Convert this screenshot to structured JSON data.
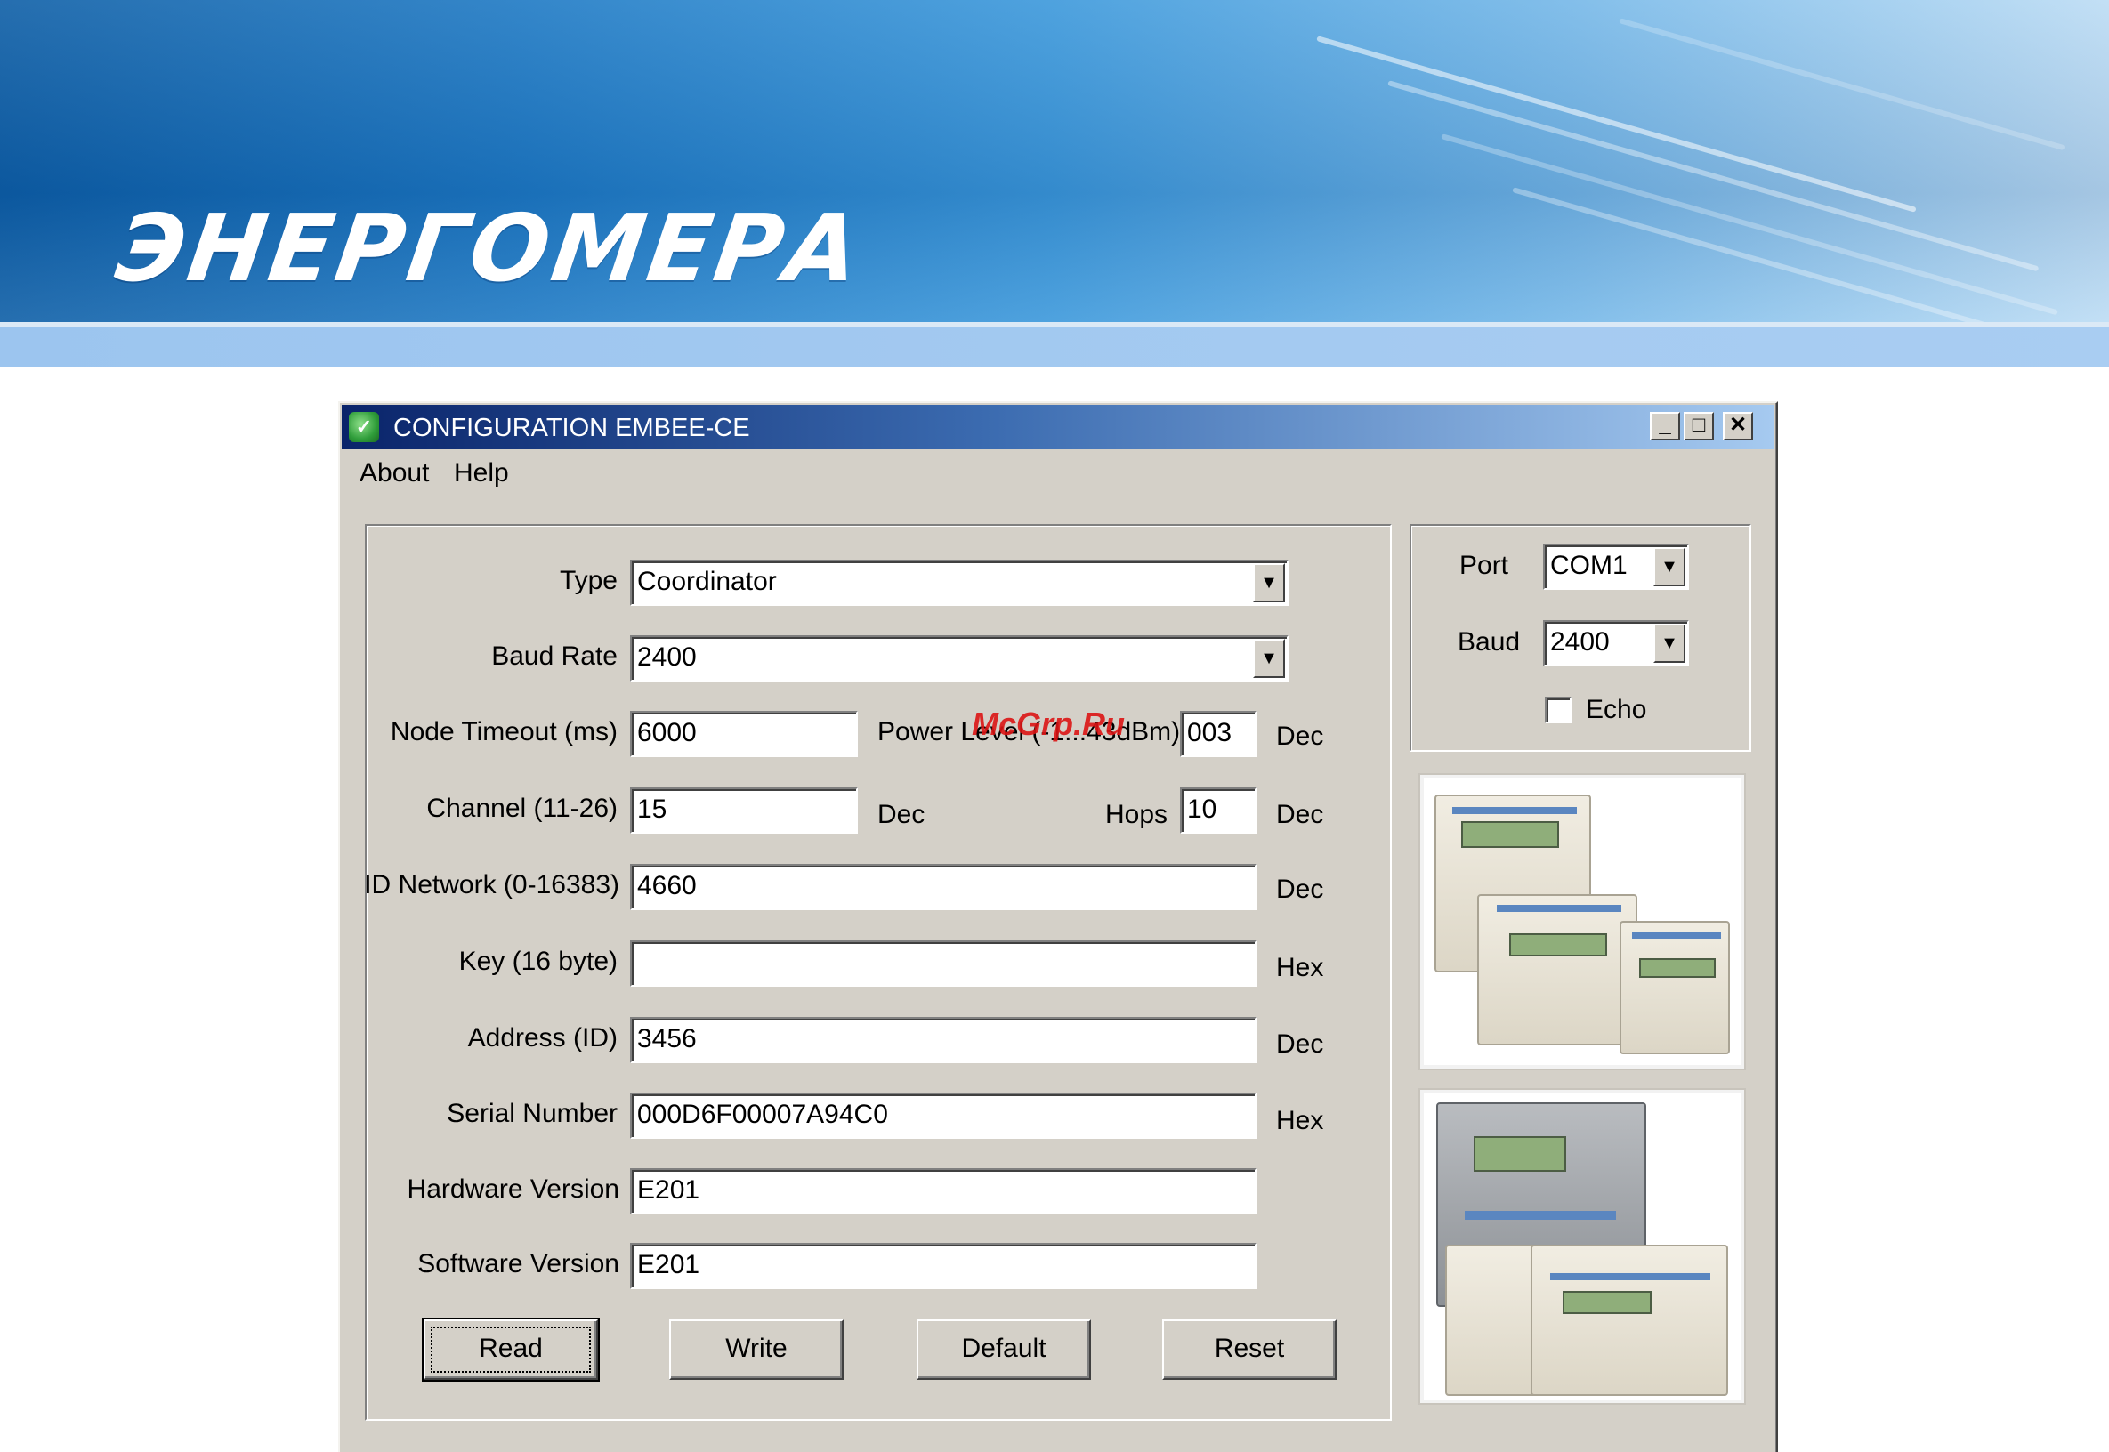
{
  "banner": {
    "logo_text": "ЭНЕРГОМЕРА"
  },
  "window": {
    "title": "CONFIGURATION EMBEE-CE",
    "minimize": "_",
    "maximize": "□",
    "close": "✕"
  },
  "menu": {
    "about": "About",
    "help": "Help"
  },
  "form": {
    "type": {
      "label": "Type",
      "value": "Coordinator"
    },
    "baud_rate": {
      "label": "Baud Rate",
      "value": "2400"
    },
    "node_timeout": {
      "label": "Node Timeout (ms)",
      "value": "6000"
    },
    "power_level": {
      "label": "Power Level (-1...43dBm)",
      "value": "003",
      "unit": "Dec"
    },
    "channel": {
      "label": "Channel (11-26)",
      "value": "15",
      "unit": "Dec"
    },
    "hops": {
      "label": "Hops",
      "value": "10",
      "unit": "Dec"
    },
    "id_network": {
      "label": "ID Network (0-16383)",
      "value": "4660",
      "unit": "Dec"
    },
    "key": {
      "label": "Key (16 byte)",
      "value": "",
      "unit": "Hex"
    },
    "address": {
      "label": "Address (ID)",
      "value": "3456",
      "unit": "Dec"
    },
    "serial_number": {
      "label": "Serial Number",
      "value": "000D6F00007A94C0",
      "unit": "Hex"
    },
    "hardware_version": {
      "label": "Hardware Version",
      "value": "E201"
    },
    "software_version": {
      "label": "Software Version",
      "value": "E201"
    }
  },
  "buttons": {
    "read": "Read",
    "write": "Write",
    "default": "Default",
    "reset": "Reset"
  },
  "connection": {
    "port": {
      "label": "Port",
      "value": "COM1"
    },
    "baud": {
      "label": "Baud",
      "value": "2400"
    },
    "echo": {
      "label": "Echo",
      "checked": false
    }
  },
  "watermark": "McGrp.Ru",
  "icons": {
    "dropdown": "▼",
    "app": "app-logo-icon"
  }
}
